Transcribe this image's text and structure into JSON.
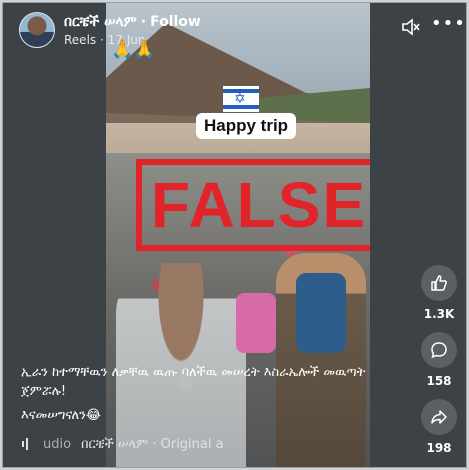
{
  "header": {
    "author": "በርቼች ሠላም",
    "follow_label": "Follow",
    "meta_source": "Reels",
    "meta_date": "17 Jun"
  },
  "video": {
    "overlay_text": "Happy trip",
    "stamp_text": "FALSE",
    "emoji_top": "🙏🙏",
    "flag_icon": "israel-flag-icon"
  },
  "rail": {
    "like_count": "1.3K",
    "comment_count": "158",
    "share_count": "198"
  },
  "caption": {
    "text": "ኢራን ከተማቸዉን ለቃቸዉ ዉጡ ባለችዉ መሠረት እስራኤሎች መዉጣት ጀምሯሉ!",
    "emoji_line": "እናመሠግናለን😂"
  },
  "audio": {
    "label": "udio",
    "track": "በርቼች ሠላም · Original a"
  },
  "colors": {
    "stamp_red": "#e0242a",
    "panel_bg": "#3d4247"
  }
}
